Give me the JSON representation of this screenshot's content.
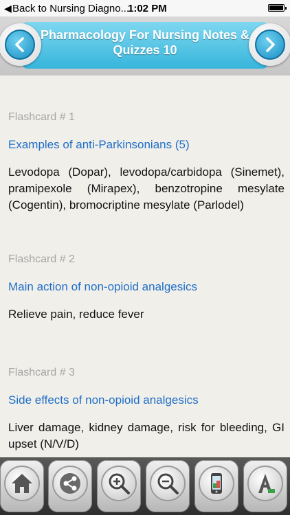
{
  "status_bar": {
    "back_arrow": "◀",
    "back_text": "Back to Nursing Diagno...",
    "time": "1:02 PM"
  },
  "header": {
    "title": "Pharmacology For Nursing  Notes & Quizzes 10",
    "prev_icon": "chevron-left-icon",
    "next_icon": "chevron-right-icon"
  },
  "flashcards": [
    {
      "number": "Flashcard # 1",
      "question": "Examples of anti-Parkinsonians (5)",
      "answer": "Levodopa (Dopar), levodopa/carbidopa (Sinemet), pramipexole (Mirapex), benzotropine mesylate (Cogentin), bromocriptine mesylate (Parlodel)"
    },
    {
      "number": "Flashcard # 2",
      "question": "Main action of non-opioid analgesics",
      "answer": "Relieve pain, reduce fever"
    },
    {
      "number": "Flashcard # 3",
      "question": "Side effects of non-opioid analgesics",
      "answer": "Liver damage, kidney damage, risk for bleeding, GI upset (N/V/D)"
    }
  ],
  "toolbar": {
    "icons": [
      "home-icon",
      "share-icon",
      "zoom-in-icon",
      "zoom-out-icon",
      "phone-icon",
      "font-icon"
    ]
  },
  "colors": {
    "banner": "#36b5dc",
    "question": "#1f6fc8",
    "card_number": "#a6a6a6",
    "background": "#f1efea"
  }
}
